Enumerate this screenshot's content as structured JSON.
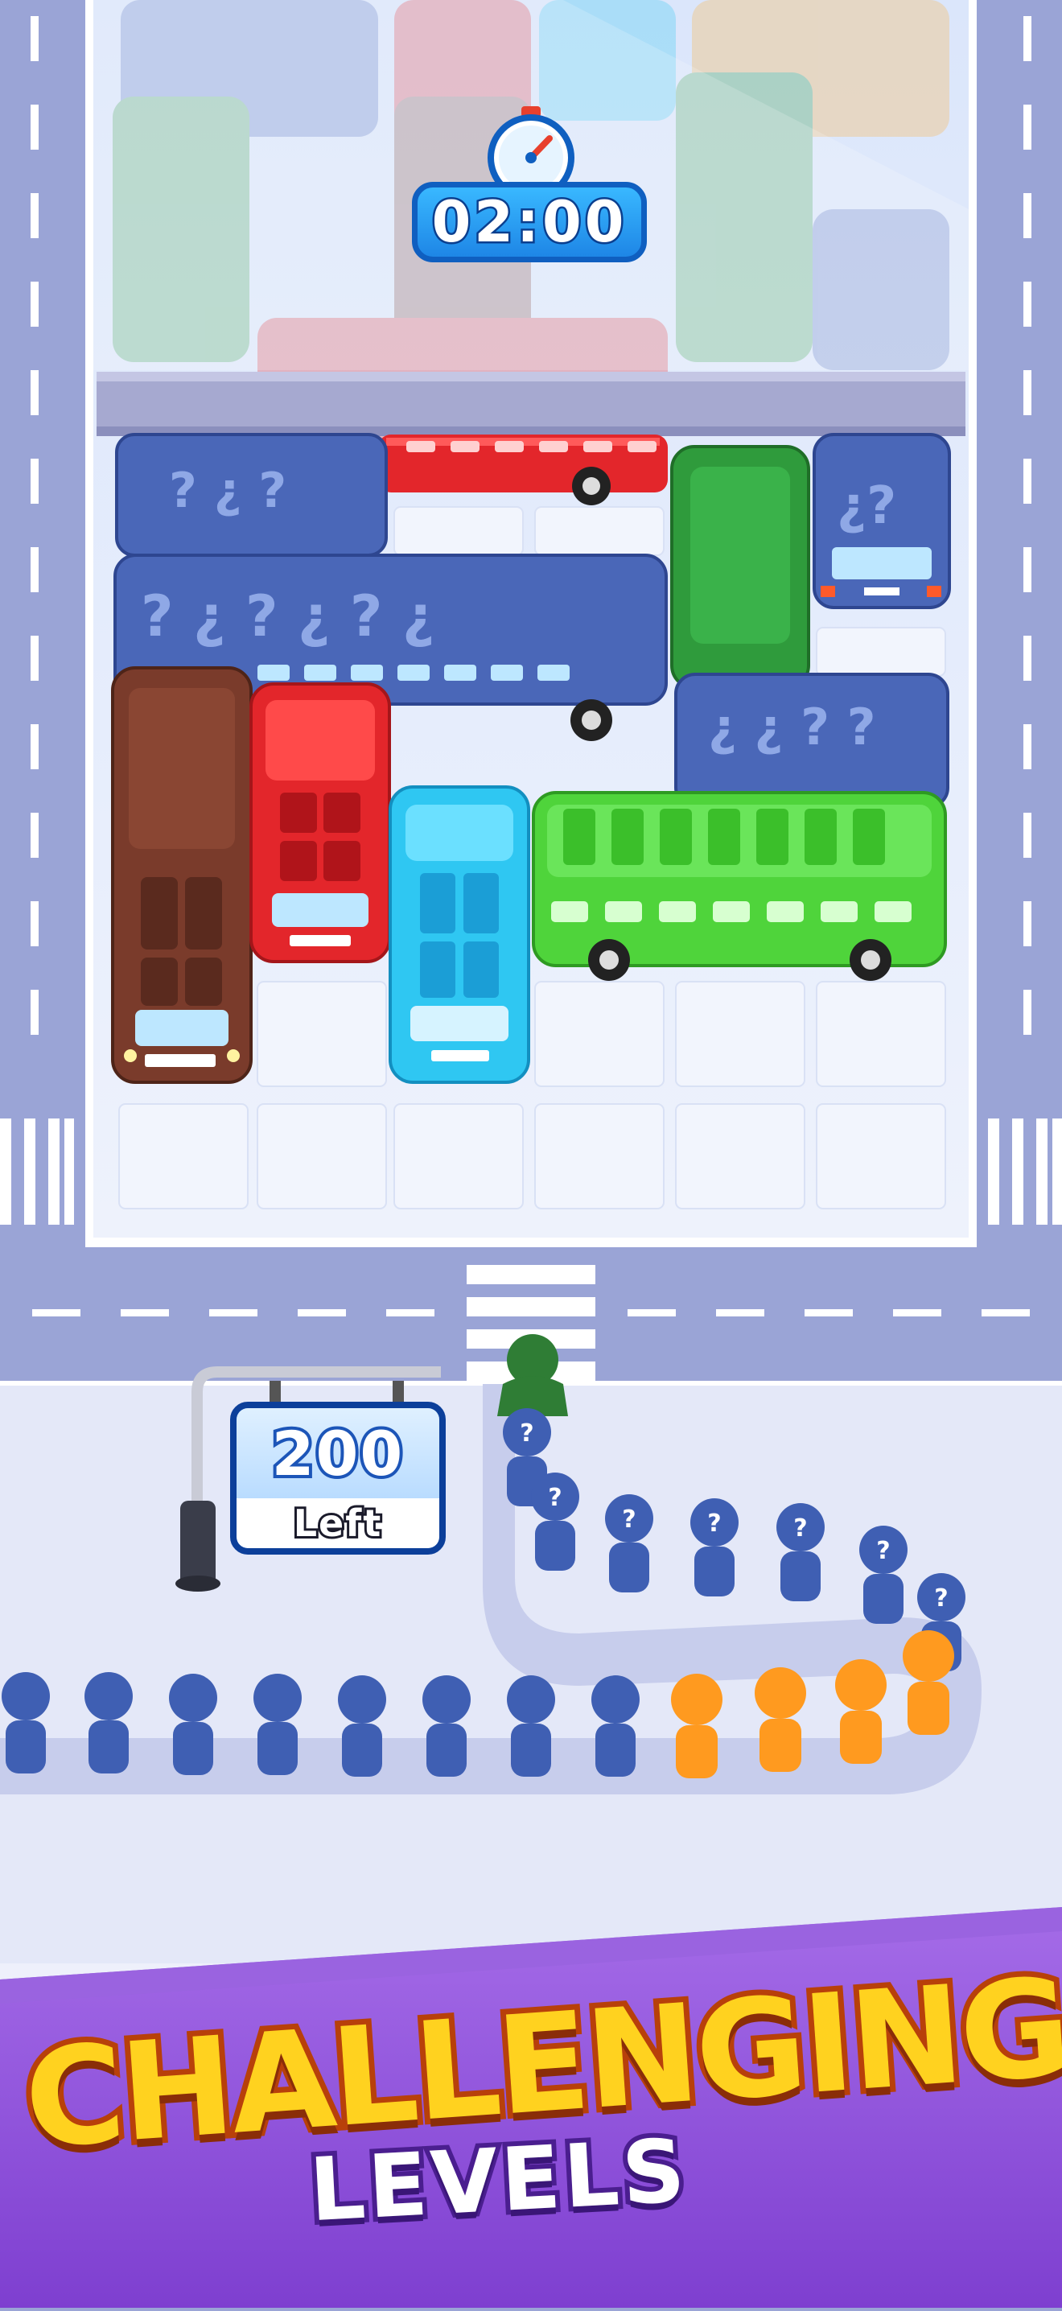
{
  "timer": {
    "value": "02:00"
  },
  "counter": {
    "count": "200",
    "label": "Left"
  },
  "banner": {
    "title": "CHALLENGING",
    "subtitle": "LEVELS"
  },
  "colors": {
    "road": "#9aa4d6",
    "lot": "#e6ecfb",
    "sidewalk": "#e4e8f8",
    "banner": "#8b55d8",
    "mystery_vehicle": "#4a67b8",
    "red_car": "#e3262b",
    "brown_car": "#7a3b2b",
    "cyan_car": "#2fc7f2",
    "green_bus": "#4fd43b",
    "dark_green_car": "#2f9b3c",
    "blue_passenger": "#3f5fb3",
    "orange_passenger": "#ff9a1f",
    "green_passenger": "#2f7d35"
  },
  "icons": {
    "timer": "stopwatch-icon",
    "mystery": "question-mark-icon"
  }
}
